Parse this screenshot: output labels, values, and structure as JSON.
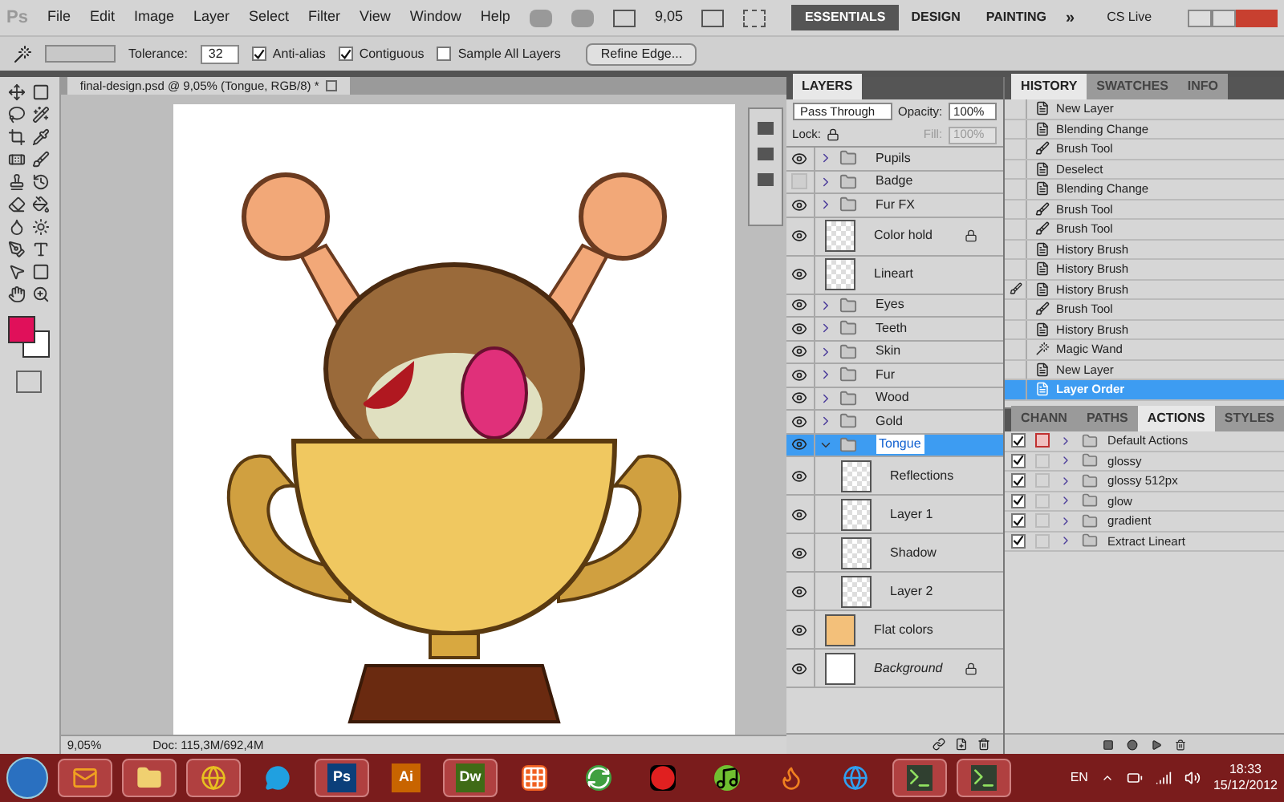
{
  "menu_bar": {
    "logo": "Ps",
    "items": [
      "File",
      "Edit",
      "Image",
      "Layer",
      "Select",
      "Filter",
      "View",
      "Window",
      "Help"
    ],
    "zoom": "9,05",
    "workspaces": [
      {
        "label": "ESSENTIALS",
        "selected": true
      },
      {
        "label": "DESIGN",
        "selected": false
      },
      {
        "label": "PAINTING",
        "selected": false
      }
    ],
    "more": "»",
    "cs_live": "CS Live"
  },
  "options_bar": {
    "tolerance_label": "Tolerance:",
    "tolerance": "32",
    "checks": [
      {
        "label": "Anti-alias",
        "checked": true
      },
      {
        "label": "Contiguous",
        "checked": true
      },
      {
        "label": "Sample All Layers",
        "checked": false
      }
    ],
    "refine": "Refine Edge..."
  },
  "document": {
    "tab": "final-design.psd @ 9,05% (Tongue, RGB/8) *",
    "zoom": "9,05%",
    "info": "Doc: 115,3M/692,4M"
  },
  "layers_panel": {
    "tab": "LAYERS",
    "blend_mode": "Pass Through",
    "opacity_label": "Opacity:",
    "opacity": "100%",
    "lock_label": "Lock:",
    "fill_label": "Fill:",
    "fill": "100%",
    "layers": [
      {
        "name": "Pupils",
        "kind": "group",
        "visible": true,
        "selected": false,
        "expanded": false
      },
      {
        "name": "Badge",
        "kind": "group",
        "visible": false,
        "selected": false,
        "expanded": false
      },
      {
        "name": "Fur FX",
        "kind": "group",
        "visible": true,
        "selected": false,
        "expanded": false
      },
      {
        "name": "Color hold",
        "kind": "layer",
        "visible": true,
        "selected": false,
        "locked": true
      },
      {
        "name": "Lineart",
        "kind": "layer",
        "visible": true,
        "selected": false,
        "locked": false
      },
      {
        "name": "Eyes",
        "kind": "group",
        "visible": true,
        "selected": false,
        "expanded": false
      },
      {
        "name": "Teeth",
        "kind": "group",
        "visible": true,
        "selected": false,
        "expanded": false
      },
      {
        "name": "Skin",
        "kind": "group",
        "visible": true,
        "selected": false,
        "expanded": false
      },
      {
        "name": "Fur",
        "kind": "group",
        "visible": true,
        "selected": false,
        "expanded": false
      },
      {
        "name": "Wood",
        "kind": "group",
        "visible": true,
        "selected": false,
        "expanded": false
      },
      {
        "name": "Gold",
        "kind": "group",
        "visible": true,
        "selected": false,
        "expanded": false
      },
      {
        "name": "Tongue",
        "kind": "group",
        "visible": true,
        "selected": true,
        "expanded": true,
        "children": [
          {
            "name": "Reflections",
            "kind": "layer",
            "visible": true,
            "selected": false,
            "locked": false
          },
          {
            "name": "Layer 1",
            "kind": "layer",
            "visible": true,
            "selected": false,
            "locked": false
          },
          {
            "name": "Shadow",
            "kind": "layer",
            "visible": true,
            "selected": false,
            "locked": false
          },
          {
            "name": "Layer 2",
            "kind": "layer",
            "visible": true,
            "selected": false,
            "locked": false
          }
        ]
      },
      {
        "name": "Flat colors",
        "kind": "image",
        "visible": true,
        "selected": false,
        "locked": false
      },
      {
        "name": "Background",
        "kind": "background",
        "visible": true,
        "selected": false,
        "locked": true
      }
    ]
  },
  "history_panel": {
    "tabs": [
      {
        "label": "HISTORY",
        "selected": true
      },
      {
        "label": "SWATCHES",
        "selected": false
      },
      {
        "label": "INFO",
        "selected": false
      }
    ],
    "steps": [
      {
        "name": "New Layer",
        "kind": "doc",
        "selected": false,
        "source": false
      },
      {
        "name": "Blending Change",
        "kind": "doc",
        "selected": false,
        "source": false
      },
      {
        "name": "Brush Tool",
        "kind": "brush",
        "selected": false,
        "source": false
      },
      {
        "name": "Deselect",
        "kind": "doc",
        "selected": false,
        "source": false
      },
      {
        "name": "Blending Change",
        "kind": "doc",
        "selected": false,
        "source": false
      },
      {
        "name": "Brush Tool",
        "kind": "brush",
        "selected": false,
        "source": false
      },
      {
        "name": "Brush Tool",
        "kind": "brush",
        "selected": false,
        "source": false
      },
      {
        "name": "History Brush",
        "kind": "doc",
        "selected": false,
        "source": false
      },
      {
        "name": "History Brush",
        "kind": "doc",
        "selected": false,
        "source": false
      },
      {
        "name": "History Brush",
        "kind": "doc",
        "selected": false,
        "source": true
      },
      {
        "name": "Brush Tool",
        "kind": "brush",
        "selected": false,
        "source": false
      },
      {
        "name": "History Brush",
        "kind": "doc",
        "selected": false,
        "source": false
      },
      {
        "name": "Magic Wand",
        "kind": "wand",
        "selected": false,
        "source": false
      },
      {
        "name": "New Layer",
        "kind": "doc",
        "selected": false,
        "source": false
      },
      {
        "name": "Layer Order",
        "kind": "doc",
        "selected": true,
        "source": false
      }
    ]
  },
  "actions_panel": {
    "tabs": [
      {
        "label": "CHANN",
        "selected": false
      },
      {
        "label": "PATHS",
        "selected": false
      },
      {
        "label": "ACTIONS",
        "selected": true
      },
      {
        "label": "STYLES",
        "selected": false
      }
    ],
    "sets": [
      {
        "name": "Default Actions",
        "checked": true,
        "dialog": true
      },
      {
        "name": "glossy",
        "checked": true,
        "dialog": false
      },
      {
        "name": "glossy 512px",
        "checked": true,
        "dialog": false
      },
      {
        "name": "glow",
        "checked": true,
        "dialog": false
      },
      {
        "name": "gradient",
        "checked": true,
        "dialog": false
      },
      {
        "name": "Extract Lineart",
        "checked": true,
        "dialog": false
      }
    ]
  },
  "taskbar": {
    "apps": [
      {
        "kind": "mail",
        "running": true
      },
      {
        "kind": "folder",
        "running": true
      },
      {
        "kind": "globe",
        "running": true
      },
      {
        "kind": "chat",
        "running": false
      },
      {
        "kind": "tile",
        "label": "Ps",
        "color": "#0b3f7a",
        "running": true
      },
      {
        "kind": "tile",
        "label": "Ai",
        "color": "#c86400",
        "running": false
      },
      {
        "kind": "tile",
        "label": "Dw",
        "color": "#3f6b16",
        "running": true
      },
      {
        "kind": "grid",
        "running": false
      },
      {
        "kind": "sync",
        "running": false
      },
      {
        "kind": "record",
        "running": false
      },
      {
        "kind": "music",
        "running": false
      },
      {
        "kind": "fox",
        "running": false
      },
      {
        "kind": "ie",
        "running": false
      },
      {
        "kind": "console",
        "running": true
      },
      {
        "kind": "console",
        "running": true
      }
    ],
    "language": "EN",
    "time": "18:33",
    "date": "15/12/2012"
  }
}
